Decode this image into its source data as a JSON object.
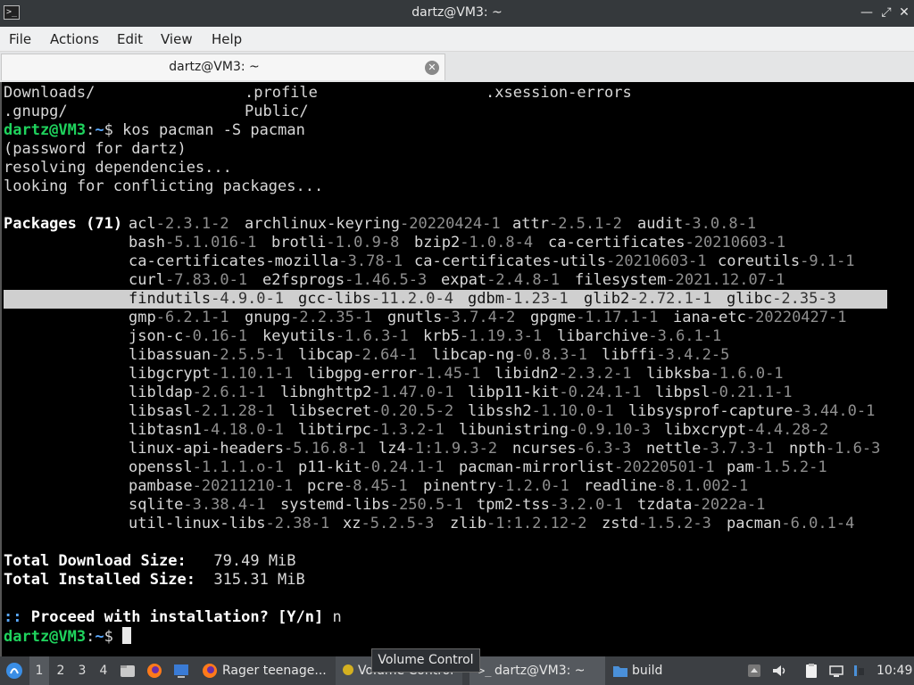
{
  "window": {
    "title": "dartz@VM3: ~",
    "icon": "terminal-icon",
    "controls": [
      "minimize-icon",
      "maximize-icon",
      "close-icon"
    ]
  },
  "menu": [
    "File",
    "Actions",
    "Edit",
    "View",
    "Help"
  ],
  "tab": {
    "label": "dartz@VM3: ~"
  },
  "terminal": {
    "ls1": [
      "Downloads/",
      ".profile",
      ".xsession-errors"
    ],
    "ls2": [
      ".gnupg/",
      "Public/"
    ],
    "prompt_user": "dartz@VM3",
    "prompt_sep": ":",
    "prompt_path": "~",
    "prompt_sym": "$ ",
    "command": "kos pacman -S pacman",
    "out1": "(password for dartz)",
    "out2": "resolving dependencies...",
    "out3": "looking for conflicting packages...",
    "packages_label": "Packages (71)",
    "package_rows": [
      [
        [
          "acl",
          "-2.3.1-2"
        ],
        [
          "archlinux-keyring",
          "-20220424-1"
        ],
        [
          "attr",
          "-2.5.1-2"
        ],
        [
          "audit",
          "-3.0.8-1"
        ]
      ],
      [
        [
          "bash",
          "-5.1.016-1"
        ],
        [
          "brotli",
          "-1.0.9-8"
        ],
        [
          "bzip2",
          "-1.0.8-4"
        ],
        [
          "ca-certificates",
          "-20210603-1"
        ]
      ],
      [
        [
          "ca-certificates-mozilla",
          "-3.78-1"
        ],
        [
          "ca-certificates-utils",
          "-20210603-1"
        ],
        [
          "coreutils",
          "-9.1-1"
        ]
      ],
      [
        [
          "curl",
          "-7.83.0-1"
        ],
        [
          "e2fsprogs",
          "-1.46.5-3"
        ],
        [
          "expat",
          "-2.4.8-1"
        ],
        [
          "filesystem",
          "-2021.12.07-1"
        ]
      ],
      [
        [
          "findutils",
          "-4.9.0-1"
        ],
        [
          "gcc-libs",
          "-11.2.0-4"
        ],
        [
          "gdbm",
          "-1.23-1"
        ],
        [
          "glib2",
          "-2.72.1-1"
        ],
        [
          "glibc",
          "-2.35-3"
        ]
      ],
      [
        [
          "gmp",
          "-6.2.1-1"
        ],
        [
          "gnupg",
          "-2.2.35-1"
        ],
        [
          "gnutls",
          "-3.7.4-2"
        ],
        [
          "gpgme",
          "-1.17.1-1"
        ],
        [
          "iana-etc",
          "-20220427-1"
        ]
      ],
      [
        [
          "json-c",
          "-0.16-1"
        ],
        [
          "keyutils",
          "-1.6.3-1"
        ],
        [
          "krb5",
          "-1.19.3-1"
        ],
        [
          "libarchive",
          "-3.6.1-1"
        ]
      ],
      [
        [
          "libassuan",
          "-2.5.5-1"
        ],
        [
          "libcap",
          "-2.64-1"
        ],
        [
          "libcap-ng",
          "-0.8.3-1"
        ],
        [
          "libffi",
          "-3.4.2-5"
        ]
      ],
      [
        [
          "libgcrypt",
          "-1.10.1-1"
        ],
        [
          "libgpg-error",
          "-1.45-1"
        ],
        [
          "libidn2",
          "-2.3.2-1"
        ],
        [
          "libksba",
          "-1.6.0-1"
        ]
      ],
      [
        [
          "libldap",
          "-2.6.1-1"
        ],
        [
          "libnghttp2",
          "-1.47.0-1"
        ],
        [
          "libp11-kit",
          "-0.24.1-1"
        ],
        [
          "libpsl",
          "-0.21.1-1"
        ]
      ],
      [
        [
          "libsasl",
          "-2.1.28-1"
        ],
        [
          "libsecret",
          "-0.20.5-2"
        ],
        [
          "libssh2",
          "-1.10.0-1"
        ],
        [
          "libsysprof-capture",
          "-3.44.0-1"
        ]
      ],
      [
        [
          "libtasn1",
          "-4.18.0-1"
        ],
        [
          "libtirpc",
          "-1.3.2-1"
        ],
        [
          "libunistring",
          "-0.9.10-3"
        ],
        [
          "libxcrypt",
          "-4.4.28-2"
        ]
      ],
      [
        [
          "linux-api-headers",
          "-5.16.8-1"
        ],
        [
          "lz4",
          "-1:1.9.3-2"
        ],
        [
          "ncurses",
          "-6.3-3"
        ],
        [
          "nettle",
          "-3.7.3-1"
        ],
        [
          "npth",
          "-1.6-3"
        ]
      ],
      [
        [
          "openssl",
          "-1.1.1.o-1"
        ],
        [
          "p11-kit",
          "-0.24.1-1"
        ],
        [
          "pacman-mirrorlist",
          "-20220501-1"
        ],
        [
          "pam",
          "-1.5.2-1"
        ]
      ],
      [
        [
          "pambase",
          "-20211210-1"
        ],
        [
          "pcre",
          "-8.45-1"
        ],
        [
          "pinentry",
          "-1.2.0-1"
        ],
        [
          "readline",
          "-8.1.002-1"
        ]
      ],
      [
        [
          "sqlite",
          "-3.38.4-1"
        ],
        [
          "systemd-libs",
          "-250.5-1"
        ],
        [
          "tpm2-tss",
          "-3.2.0-1"
        ],
        [
          "tzdata",
          "-2022a-1"
        ]
      ],
      [
        [
          "util-linux-libs",
          "-2.38-1"
        ],
        [
          "xz",
          "-5.2.5-3"
        ],
        [
          "zlib",
          "-1:1.2.12-2"
        ],
        [
          "zstd",
          "-1.5.2-3"
        ],
        [
          "pacman",
          "-6.0.1-4"
        ]
      ]
    ],
    "highlighted_row": 4,
    "dl_label": "Total Download Size:",
    "dl_value": "   79.49 MiB",
    "inst_label": "Total Installed Size:",
    "inst_value": "  315.31 MiB",
    "proceed_prefix": ":: ",
    "proceed_text": "Proceed with installation? [Y/n]",
    "proceed_answer": " n"
  },
  "taskbar": {
    "workspaces": [
      "1",
      "2",
      "3",
      "4"
    ],
    "active_workspace": "1",
    "tasks": [
      "Rager teenage...",
      "Volume Control",
      "dartz@VM3: ~",
      "build"
    ],
    "tooltip": "Volume Control",
    "clock": "10:49"
  }
}
